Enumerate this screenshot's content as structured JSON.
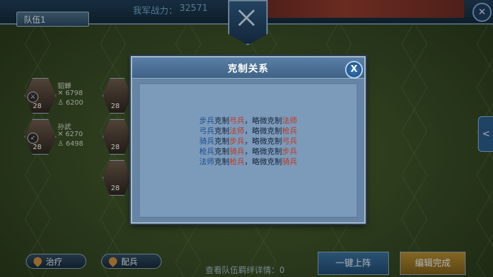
{
  "top": {
    "team_tab": "队伍1",
    "power_label": "我军战力：",
    "power_value": "32571"
  },
  "heroes": [
    {
      "name": "貂蝉",
      "stat1": "✕ 6798",
      "stat2": "♙ 6200",
      "level": "28",
      "class_icon": "mage-icon"
    },
    {
      "name": "孙武",
      "stat1": "✕ 6270",
      "stat2": "♙ 6498",
      "level": "28",
      "class_icon": "archer-icon"
    }
  ],
  "hero_levels_right": [
    "28",
    "28",
    "28"
  ],
  "modal": {
    "title": "克制关系",
    "close_label": "X",
    "rules": [
      {
        "attacker": "步兵",
        "mid1": "克制",
        "strong": "弓兵",
        "mid2": "，略微克制",
        "weak": "法师"
      },
      {
        "attacker": "弓兵",
        "mid1": "克制",
        "strong": "法师",
        "mid2": "，略微克制",
        "weak": "枪兵"
      },
      {
        "attacker": "骑兵",
        "mid1": "克制",
        "strong": "步兵",
        "mid2": "，略微克制",
        "weak": "弓兵"
      },
      {
        "attacker": "枪兵",
        "mid1": "克制",
        "strong": "骑兵",
        "mid2": "，略微克制",
        "weak": "步兵"
      },
      {
        "attacker": "法师",
        "mid1": "克制",
        "strong": "枪兵",
        "mid2": "，略微克制",
        "weak": "骑兵"
      }
    ]
  },
  "bottom": {
    "heal_label": "治疗",
    "assign_label": "配兵",
    "hint": "查看队伍羁绊详情：0",
    "one_click_label": "一键上阵",
    "finish_label": "编辑完成"
  },
  "side_tab_label": "<",
  "colors": {
    "accent_red": "#c0371e",
    "accent_blue": "#1b4f8e",
    "modal_bg": "#7c9aba"
  }
}
